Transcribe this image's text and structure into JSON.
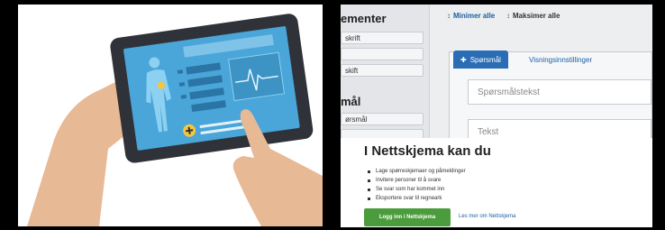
{
  "illustration": {
    "icon": "tablet-medical-illustration-icon",
    "colors": {
      "skin": "#e8b995",
      "tablet": "#2f3238",
      "screen": "#4aa5d8",
      "accent": "#f6c63b"
    }
  },
  "app": {
    "sidebar": {
      "section1_title": "ementer",
      "section1_items": [
        "skrift",
        "",
        "skift"
      ],
      "section2_title": "mål",
      "section2_items": [
        "ørsmål",
        ""
      ]
    },
    "toolbar": {
      "minimize_label": "Minimer alle",
      "maximize_label": "Maksimer alle"
    },
    "editor": {
      "tabs": [
        {
          "label": "Spørsmål",
          "icon": "plus-icon",
          "active": true
        },
        {
          "label": "Visningsinnstillinger",
          "active": false
        }
      ],
      "question_placeholder": "Spørsmålstekst",
      "text_placeholder": "Tekst"
    },
    "info": {
      "heading": "I Nettskjema kan du",
      "bullets": [
        "Lage spørreskjemaer og påmeldinger",
        "Invitere personer til å svare",
        "Se svar som har kommet inn",
        "Eksportere svar til regneark"
      ],
      "login_button": "Logg inn i Nettskjema",
      "more_link": "Les mer om Nettskjema"
    },
    "colors": {
      "primary_blue": "#2a6db4",
      "green_button": "#4b9c3c"
    }
  }
}
